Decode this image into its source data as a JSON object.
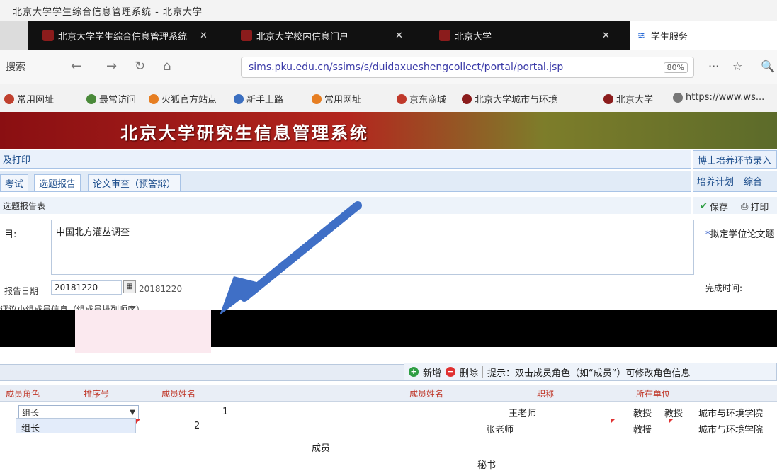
{
  "window": {
    "title": "北京大学学生综合信息管理系统 - 北京大学"
  },
  "tabs": [
    {
      "label": "北京大学学生综合信息管理系统"
    },
    {
      "label": "北京大学校内信息门户"
    },
    {
      "label": "北京大学"
    },
    {
      "label": "学生服务"
    }
  ],
  "nav": {
    "search_label": "搜索",
    "url": "sims.pku.edu.cn/ssims/s/duidaxueshengcollect/portal/portal.jsp",
    "zoom": "80%"
  },
  "bookmarks": [
    "常用网址",
    "最常访问",
    "火狐官方站点",
    "新手上路",
    "常用网址",
    "京东商城",
    "北京大学城市与环境",
    "北京大学",
    "https://www.ws..."
  ],
  "banner": {
    "title": "北京大学研究生信息管理系统"
  },
  "left_panel": {
    "header": "及打印",
    "tabs": [
      "考试",
      "选题报告",
      "论文审查（预答辩）"
    ],
    "section": "选题报告表",
    "topic_label": "目:",
    "topic_value": "中国北方灌丛调查",
    "date_label": "报告日期",
    "date_value": "20181220",
    "date_value2": "20181220",
    "hint": "评议小组成员信息（组成员排列顺序）"
  },
  "right_panel": {
    "header": "博士培养环节录入",
    "tabs": [
      "培养计划",
      "综合"
    ],
    "save": "保存",
    "print": "打印",
    "field1": "拟定学位论文题",
    "field2": "完成时间:"
  },
  "toolbar": {
    "add": "新增",
    "delete": "删除",
    "tip": "提示：双击成员角色（如“成员”）可修改角色信息"
  },
  "left_grid": {
    "headers": [
      "成员角色",
      "排序号",
      "成员姓名"
    ],
    "dropdown_value": "组长",
    "rows": [
      {
        "role": "组长",
        "order": "1"
      },
      {
        "role": "组长",
        "order": "2"
      },
      {
        "role": "成员",
        "order": ""
      }
    ]
  },
  "right_grid": {
    "headers": [
      "成员姓名",
      "职称",
      "所在单位"
    ],
    "rows": [
      {
        "name": "王老师",
        "title": "教授",
        "title2": "教授",
        "unit": "城市与环境学院"
      },
      {
        "name": "张老师",
        "title": "教授",
        "title2": "",
        "unit": "城市与环境学院"
      },
      {
        "name": "秘书",
        "title": "",
        "title2": "",
        "unit": ""
      }
    ]
  },
  "colors": {
    "banner": "#b3261e",
    "accent": "#1d4e8c",
    "arrow": "#3f6fc6"
  }
}
